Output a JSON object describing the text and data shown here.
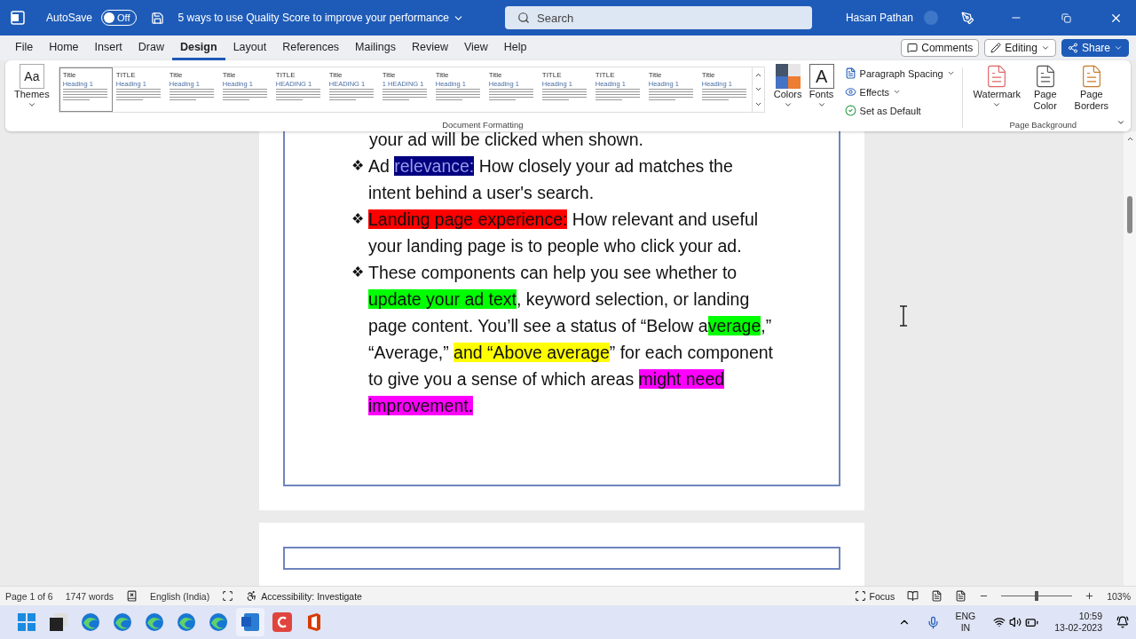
{
  "titlebar": {
    "autosave_label": "AutoSave",
    "autosave": {
      "on": false,
      "label": "Off"
    },
    "doc_title": "5 ways to use Quality Score to improve your performance",
    "search_placeholder": "Search",
    "user": "Hasan Pathan"
  },
  "menu_tabs": [
    {
      "label": "File",
      "selected": false
    },
    {
      "label": "Home",
      "selected": false
    },
    {
      "label": "Insert",
      "selected": false
    },
    {
      "label": "Draw",
      "selected": false
    },
    {
      "label": "Design",
      "selected": true
    },
    {
      "label": "Layout",
      "selected": false
    },
    {
      "label": "References",
      "selected": false
    },
    {
      "label": "Mailings",
      "selected": false
    },
    {
      "label": "Review",
      "selected": false
    },
    {
      "label": "View",
      "selected": false
    },
    {
      "label": "Help",
      "selected": false
    }
  ],
  "actions": {
    "comments": "Comments",
    "editing": "Editing",
    "share": "Share"
  },
  "ribbon": {
    "themes": {
      "glyph": "Aa",
      "label": "Themes"
    },
    "styles": [
      {
        "title": "Title",
        "heading": "Heading 1",
        "selected": true
      },
      {
        "title": "TITLE",
        "heading": "Heading 1",
        "selected": false
      },
      {
        "title": "Title",
        "heading": "Heading 1",
        "selected": false
      },
      {
        "title": "Title",
        "heading": "Heading 1",
        "selected": false
      },
      {
        "title": "TITLE",
        "heading": "HEADING 1",
        "selected": false
      },
      {
        "title": "Title",
        "heading": "HEADING 1",
        "selected": false
      },
      {
        "title": "Title",
        "heading": "1 HEADING 1",
        "selected": false
      },
      {
        "title": "Title",
        "heading": "Heading 1",
        "selected": false
      },
      {
        "title": "Title",
        "heading": "Heading 1",
        "selected": false
      },
      {
        "title": "TITLE",
        "heading": "Heading 1",
        "selected": false
      },
      {
        "title": "TITLE",
        "heading": "Heading 1",
        "selected": false
      },
      {
        "title": "Title",
        "heading": "Heading 1",
        "selected": false
      },
      {
        "title": "Title",
        "heading": "Heading 1",
        "selected": false
      }
    ],
    "colors_label": "Colors",
    "fonts": {
      "glyph": "A",
      "label": "Fonts"
    },
    "paragraph_spacing": "Paragraph Spacing",
    "effects": "Effects",
    "set_default": "Set as Default",
    "group_doc": "Document Formatting",
    "watermark": "Watermark",
    "page_color": "Page Color",
    "page_borders": "Page Borders",
    "group_bg": "Page Background"
  },
  "document": {
    "continuation": "your ad will be clicked when shown.",
    "bullets": [
      {
        "marker": "❖",
        "segments": [
          {
            "text": "Ad "
          },
          {
            "text": "relevance:",
            "color": "#000080"
          },
          {
            "text": " How closely your ad matches the intent behind a user's search."
          }
        ]
      },
      {
        "marker": "❖",
        "segments": [
          {
            "text": "Landing page experience:",
            "color": "#ff0000"
          },
          {
            "text": " How relevant and useful your landing page is to people who click your ad."
          }
        ]
      },
      {
        "marker": "❖",
        "segments": [
          {
            "text": "These components can help you see whether to "
          },
          {
            "text": "update your ad text",
            "color": "#00ff00"
          },
          {
            "text": ", keyword selection, or landing page content. You’ll see a status of “Below a"
          },
          {
            "text": "verage",
            "color": "#00ff00"
          },
          {
            "text": ",” “Average,” "
          },
          {
            "text": "and “Above average",
            "color": "#ffff00"
          },
          {
            "text": "” for each component to give you a sense of which areas "
          },
          {
            "text": "might need improvement.",
            "color": "#ff00ff"
          }
        ]
      }
    ]
  },
  "status_bar": {
    "page": "Page 1 of 6",
    "words": "1747 words",
    "language": "English (India)",
    "accessibility": "Accessibility: Investigate",
    "focus": "Focus",
    "zoom": {
      "level": 0.5
    },
    "zoom_text": "103%"
  },
  "taskbar": {
    "lang_top": "ENG",
    "lang_bottom": "IN",
    "time": "10:59",
    "date": "13-02-2023"
  }
}
